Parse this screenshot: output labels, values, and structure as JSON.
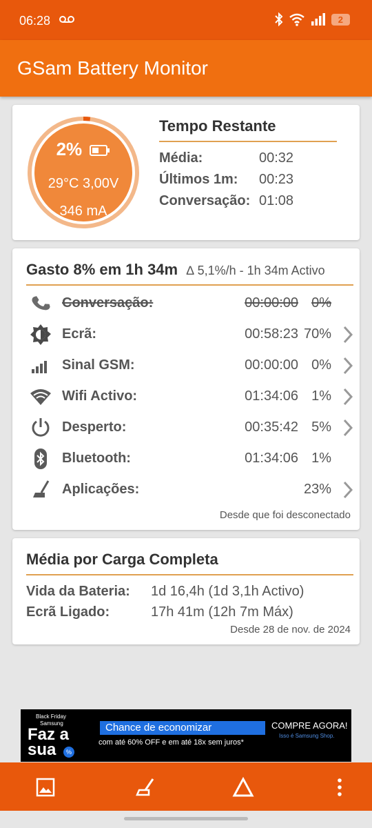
{
  "status": {
    "time": "06:28",
    "badge": "2"
  },
  "app": {
    "title": "GSam Battery Monitor"
  },
  "gauge": {
    "percent": "2%",
    "temp_volt": "29°C  3,00V",
    "current": "346 mA",
    "level": 0.02
  },
  "remaining": {
    "title": "Tempo Restante",
    "rows": [
      {
        "label": "Média:",
        "value": "00:32"
      },
      {
        "label": "Últimos 1m:",
        "value": "00:23"
      },
      {
        "label": "Conversação:",
        "value": "01:08"
      }
    ]
  },
  "usage": {
    "title": "Gasto 8% em 1h 34m",
    "subtitle": "∆ 5,1%/h - 1h 34m Activo",
    "items": [
      {
        "label": "Conversação:",
        "duration": "00:00:00",
        "percent": "0%",
        "icon": "phone-icon"
      },
      {
        "label": "Ecrã:",
        "duration": "00:58:23",
        "percent": "70%",
        "icon": "brightness-icon"
      },
      {
        "label": "Sinal GSM:",
        "duration": "00:00:00",
        "percent": "0%",
        "icon": "signal-icon"
      },
      {
        "label": "Wifi Activo:",
        "duration": "01:34:06",
        "percent": "1%",
        "icon": "wifi-icon"
      },
      {
        "label": "Desperto:",
        "duration": "00:35:42",
        "percent": "5%",
        "icon": "power-icon"
      },
      {
        "label": "Bluetooth:",
        "duration": "01:34:06",
        "percent": "1%",
        "icon": "bluetooth-icon"
      },
      {
        "label": "Aplicações:",
        "duration": "",
        "percent": "23%",
        "icon": "broom-icon"
      }
    ],
    "footer": "Desde que foi desconectado"
  },
  "average": {
    "title": "Média por Carga Completa",
    "rows": [
      {
        "label": "Vida da Bateria:",
        "value": "1d 16,4h (1d 3,1h Activo)"
      },
      {
        "label": "Ecrã Ligado:",
        "value": "17h 41m (12h 7m Máx)"
      }
    ],
    "footer": "Desde 28 de nov. de 2024"
  },
  "ad": {
    "tag_top": "Black Friday",
    "tag_brand": "Samsung",
    "big1": "Faz a",
    "big2": "sua",
    "headline": "Chance de economizar",
    "sub": "com até 60% OFF e em até 18x sem juros*",
    "cta": "COMPRE AGORA!",
    "cta_sub": "Isso é Samsung Shop."
  },
  "colors": {
    "accent": "#f06f10",
    "status": "#e8580c",
    "gauge": "#f0883a"
  }
}
